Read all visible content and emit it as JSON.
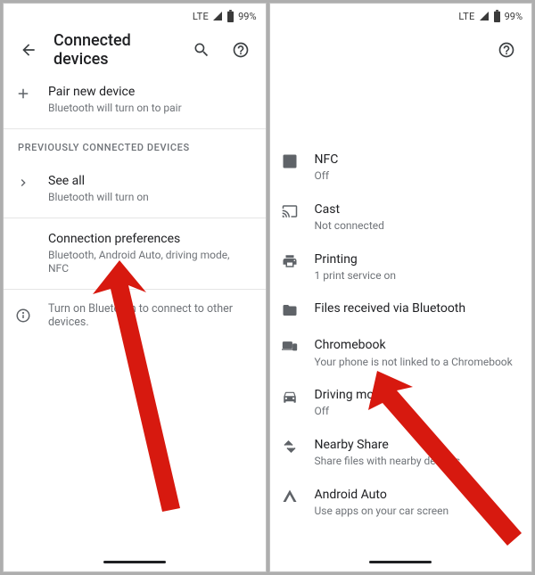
{
  "status": {
    "network": "LTE",
    "battery": "99%"
  },
  "left": {
    "title": "Connected devices",
    "pair": {
      "title": "Pair new device",
      "subtitle": "Bluetooth will turn on to pair"
    },
    "prev_header": "PREVIOUSLY CONNECTED DEVICES",
    "seeall": {
      "title": "See all",
      "subtitle": "Bluetooth will turn on"
    },
    "connprefs": {
      "title": "Connection preferences",
      "subtitle": "Bluetooth, Android Auto, driving mode, NFC"
    },
    "hint": "Turn on Bluetooth to connect to other devices."
  },
  "right": {
    "nfc": {
      "title": "NFC",
      "subtitle": "Off"
    },
    "cast": {
      "title": "Cast",
      "subtitle": "Not connected"
    },
    "printing": {
      "title": "Printing",
      "subtitle": "1 print service on"
    },
    "files": {
      "title": "Files received via Bluetooth"
    },
    "chromebook": {
      "title": "Chromebook",
      "subtitle": "Your phone is not linked to a Chromebook"
    },
    "driving": {
      "title": "Driving mode",
      "subtitle": "Off"
    },
    "nearby": {
      "title": "Nearby Share",
      "subtitle": "Share files with nearby devices"
    },
    "auto": {
      "title": "Android Auto",
      "subtitle": "Use apps on your car screen"
    }
  }
}
